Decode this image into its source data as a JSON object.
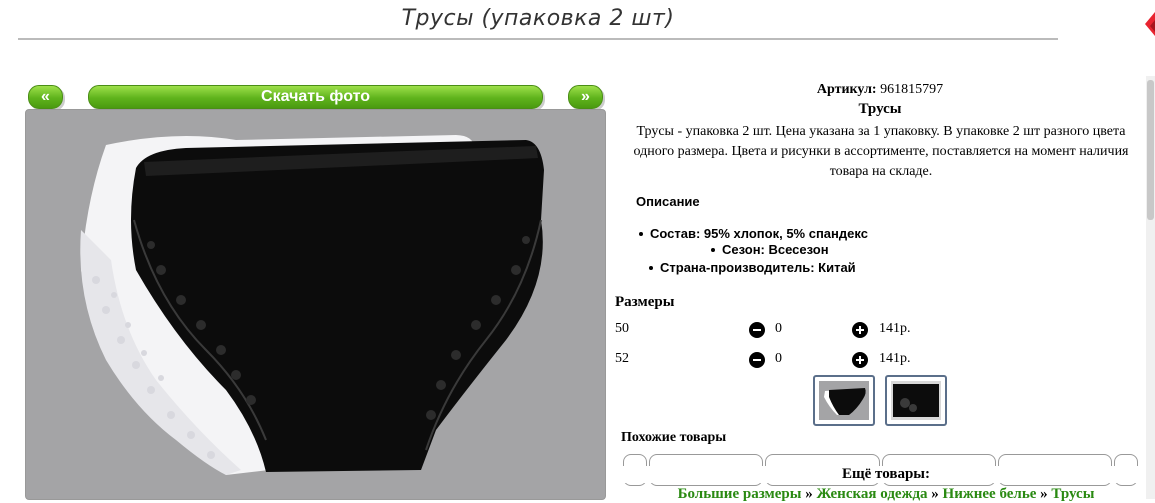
{
  "page": {
    "title": "Трусы (упаковка 2 шт)"
  },
  "gallery": {
    "prev_label": "«",
    "download_label": "Скачать фото",
    "next_label": "»"
  },
  "product": {
    "article_label": "Артикул:",
    "article_value": "961815797",
    "name": "Трусы",
    "description": "Трусы - упаковка 2 шт. Цена указана за 1 упаковку. В упаковке 2 шт разного цвета одного размера. Цвета и рисунки в ассортименте, поставляется на момент наличия товара на складе.",
    "description_heading": "Описание",
    "properties": [
      "Состав: 95% хлопок, 5% спандекс",
      "Сезон: Всесезон",
      "Страна-производитель: Китай"
    ]
  },
  "sizes": {
    "heading": "Размеры",
    "rows": [
      {
        "size": "50",
        "qty": "0",
        "price": "141р."
      },
      {
        "size": "52",
        "qty": "0",
        "price": "141р."
      }
    ]
  },
  "similar": {
    "heading": "Похожие товары"
  },
  "more": {
    "heading": "Ещё товары:",
    "crumbs": [
      "Большие размеры",
      "Женская одежда",
      "Нижнее белье",
      "Трусы"
    ],
    "separator": "»"
  },
  "colors": {
    "accent_green": "#5fb31c",
    "link_green": "#2a8a12",
    "photo_bg": "#a4a4a6"
  }
}
